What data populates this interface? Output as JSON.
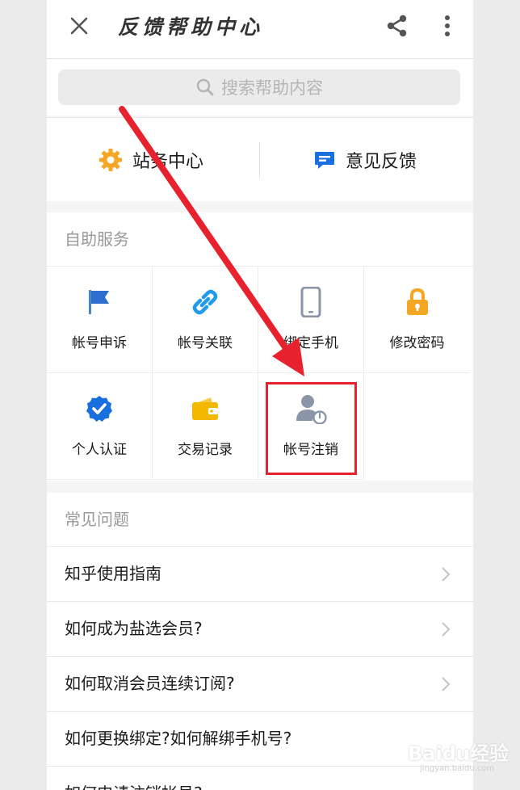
{
  "header": {
    "title": "反馈帮助中心",
    "close_icon": "close-icon",
    "share_icon": "share-icon",
    "more_icon": "more-vertical-icon"
  },
  "search": {
    "placeholder": "搜索帮助内容"
  },
  "quick_actions": [
    {
      "label": "站务中心",
      "icon": "gear-icon",
      "color": "#f5a623"
    },
    {
      "label": "意见反馈",
      "icon": "chat-bubble-icon",
      "color": "#1a6fe0"
    }
  ],
  "self_service": {
    "heading": "自助服务",
    "items": [
      {
        "label": "帐号申诉",
        "icon": "flag-icon"
      },
      {
        "label": "帐号关联",
        "icon": "link-icon"
      },
      {
        "label": "绑定手机",
        "icon": "phone-icon"
      },
      {
        "label": "修改密码",
        "icon": "lock-icon"
      },
      {
        "label": "个人认证",
        "icon": "verified-badge-icon"
      },
      {
        "label": "交易记录",
        "icon": "wallet-icon"
      },
      {
        "label": "帐号注销",
        "icon": "user-power-icon"
      }
    ]
  },
  "faq": {
    "heading": "常见问题",
    "items": [
      "知乎使用指南",
      "如何成为盐选会员?",
      "如何取消会员连续订阅?",
      "如何更换绑定?如何解绑手机号?",
      "如何申请注销帐号?"
    ]
  },
  "annotation": {
    "color": "#e8212e",
    "target": "帐号注销"
  },
  "watermark": {
    "brand": "Baidu经验",
    "url": "jingyan.baidu.com"
  }
}
